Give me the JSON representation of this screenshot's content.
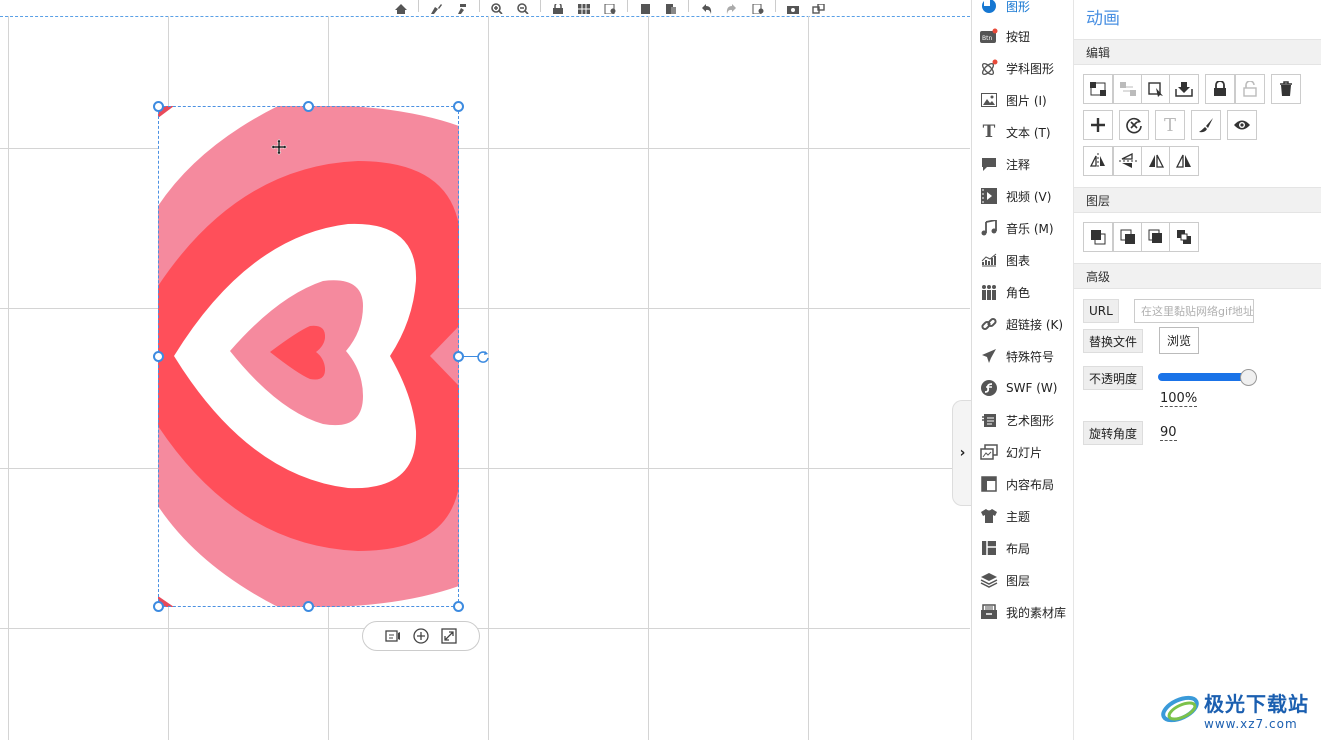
{
  "menu": {
    "items": [
      {
        "label": "图形",
        "icon": "shape-icon",
        "active": true
      },
      {
        "label": "按钮",
        "icon": "button-icon"
      },
      {
        "label": "学科图形",
        "icon": "atom-icon"
      },
      {
        "label": "图片 (I)",
        "icon": "image-icon"
      },
      {
        "label": "文本 (T)",
        "icon": "text-icon"
      },
      {
        "label": "注释",
        "icon": "comment-icon"
      },
      {
        "label": "视频 (V)",
        "icon": "video-icon"
      },
      {
        "label": "音乐 (M)",
        "icon": "music-icon"
      },
      {
        "label": "图表",
        "icon": "chart-icon"
      },
      {
        "label": "角色",
        "icon": "people-icon"
      },
      {
        "label": "超链接 (K)",
        "icon": "link-icon"
      },
      {
        "label": "特殊符号",
        "icon": "plane-icon"
      },
      {
        "label": "SWF (W)",
        "icon": "swf-icon"
      },
      {
        "label": "艺术图形",
        "icon": "art-icon"
      },
      {
        "label": "幻灯片",
        "icon": "slides-icon"
      },
      {
        "label": "内容布局",
        "icon": "content-layout-icon"
      },
      {
        "label": "主题",
        "icon": "shirt-icon"
      },
      {
        "label": "布局",
        "icon": "layout-icon"
      },
      {
        "label": "图层",
        "icon": "layers-icon"
      },
      {
        "label": "我的素材库",
        "icon": "library-icon"
      }
    ]
  },
  "props": {
    "title": "动画",
    "sections": {
      "edit": "编辑",
      "layer": "图层",
      "advanced": "高级"
    },
    "url_label": "URL",
    "url_placeholder": "在这里黏贴网络gif地址",
    "replace_label": "替换文件",
    "browse_label": "浏览",
    "opacity_label": "不透明度",
    "opacity_value": "100%",
    "opacity_fraction": 1.0,
    "rotation_label": "旋转角度",
    "rotation_value": "90"
  },
  "watermark": {
    "main": "极光下载站",
    "sub": "www.xz7.com"
  },
  "colors": {
    "accent": "#1677d2",
    "heart_outer": "#f58a9e",
    "heart_ring": "#ff4f5a",
    "heart_white": "#ffffff"
  }
}
